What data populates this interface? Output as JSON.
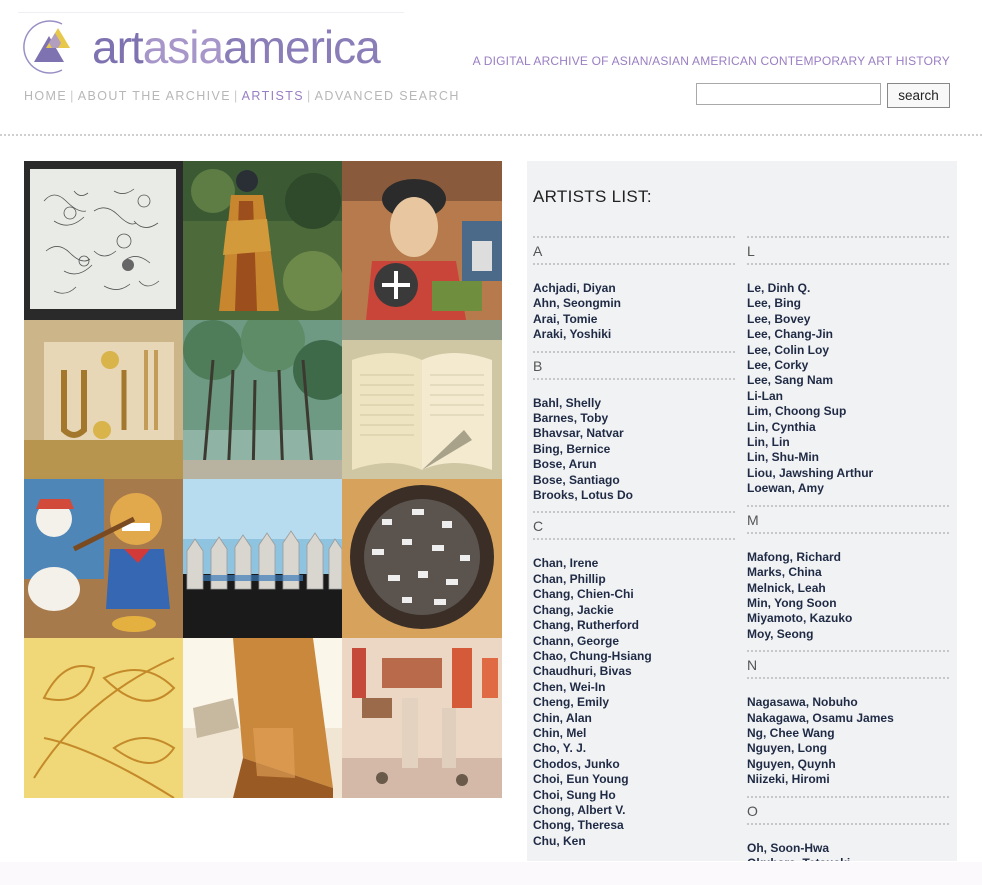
{
  "header": {
    "logo_text": [
      "art",
      "asia",
      "america"
    ],
    "tagline": "A DIGITAL ARCHIVE OF ASIAN/ASIAN AMERICAN CONTEMPORARY ART HISTORY",
    "nav": [
      "HOME",
      "ABOUT THE ARCHIVE",
      "ARTISTS",
      "ADVANCED SEARCH"
    ],
    "nav_active": "ARTISTS",
    "search": {
      "value": "",
      "button_label": "search"
    }
  },
  "colors": {
    "brand": "#8c7fb8",
    "accent": "#9a7ec2",
    "link": "#1f2a44",
    "panel_bg": "#f1f2f4"
  },
  "gallery": {
    "tiles": [
      "line-drawing-sheet",
      "figure-in-robe",
      "mural-woman",
      "wall-relief",
      "tree-park",
      "open-book",
      "cartoon-painting",
      "picket-fence",
      "sculpture-circle",
      "leaf-drawing",
      "wooden-sculpture",
      "gallery-installation"
    ]
  },
  "artists": {
    "title": "ARTISTS LIST:",
    "left": [
      {
        "letter": "A",
        "names": [
          "Achjadi, Diyan",
          "Ahn, Seongmin",
          "Arai, Tomie",
          "Araki, Yoshiki"
        ]
      },
      {
        "letter": "B",
        "names": [
          "Bahl, Shelly",
          "Barnes, Toby",
          "Bhavsar, Natvar",
          "Bing, Bernice",
          "Bose, Arun",
          "Bose, Santiago",
          "Brooks, Lotus Do"
        ]
      },
      {
        "letter": "C",
        "names": [
          "Chan, Irene",
          "Chan, Phillip",
          "Chang, Chien-Chi",
          "Chang, Jackie",
          "Chang, Rutherford",
          "Chann, George",
          "Chao, Chung-Hsiang",
          "Chaudhuri, Bivas",
          "Chen, Wei-In",
          "Cheng, Emily",
          "Chin, Alan",
          "Chin, Mel",
          "Cho, Y. J.",
          "Chodos, Junko",
          "Choi, Eun Young",
          "Choi, Sung Ho",
          "Chong, Albert V.",
          "Chong, Theresa",
          "Chu, Ken"
        ]
      }
    ],
    "right": [
      {
        "letter": "L",
        "names": [
          "Le, Dinh Q.",
          "Lee, Bing",
          "Lee, Bovey",
          "Lee, Chang-Jin",
          "Lee, Colin Loy",
          "Lee, Corky",
          "Lee, Sang Nam",
          "Li-Lan",
          "Lim, Choong Sup",
          "Lin, Cynthia",
          "Lin, Lin",
          "Lin, Shu-Min",
          "Liou, Jawshing Arthur",
          "Loewan, Amy"
        ]
      },
      {
        "letter": "M",
        "names": [
          "Mafong, Richard",
          "Marks, China",
          "Melnick, Leah",
          "Min, Yong Soon",
          "Miyamoto, Kazuko",
          "Moy, Seong"
        ]
      },
      {
        "letter": "N",
        "names": [
          "Nagasawa, Nobuho",
          "Nakagawa, Osamu James",
          "Ng, Chee Wang",
          "Nguyen, Long",
          "Nguyen, Quynh",
          "Niizeki, Hiromi"
        ]
      },
      {
        "letter": "O",
        "names": [
          "Oh, Soon-Hwa",
          "Okuhara, Tetsuaki"
        ]
      }
    ]
  }
}
